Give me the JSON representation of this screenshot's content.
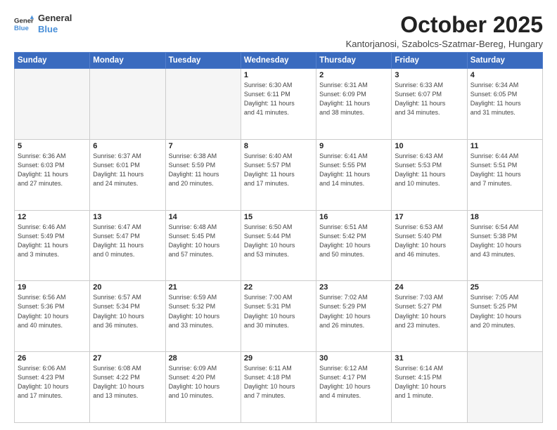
{
  "header": {
    "logo_line1": "General",
    "logo_line2": "Blue",
    "month_title": "October 2025",
    "location": "Kantorjanosi, Szabolcs-Szatmar-Bereg, Hungary"
  },
  "weekdays": [
    "Sunday",
    "Monday",
    "Tuesday",
    "Wednesday",
    "Thursday",
    "Friday",
    "Saturday"
  ],
  "weeks": [
    [
      {
        "day": "",
        "info": ""
      },
      {
        "day": "",
        "info": ""
      },
      {
        "day": "",
        "info": ""
      },
      {
        "day": "1",
        "info": "Sunrise: 6:30 AM\nSunset: 6:11 PM\nDaylight: 11 hours\nand 41 minutes."
      },
      {
        "day": "2",
        "info": "Sunrise: 6:31 AM\nSunset: 6:09 PM\nDaylight: 11 hours\nand 38 minutes."
      },
      {
        "day": "3",
        "info": "Sunrise: 6:33 AM\nSunset: 6:07 PM\nDaylight: 11 hours\nand 34 minutes."
      },
      {
        "day": "4",
        "info": "Sunrise: 6:34 AM\nSunset: 6:05 PM\nDaylight: 11 hours\nand 31 minutes."
      }
    ],
    [
      {
        "day": "5",
        "info": "Sunrise: 6:36 AM\nSunset: 6:03 PM\nDaylight: 11 hours\nand 27 minutes."
      },
      {
        "day": "6",
        "info": "Sunrise: 6:37 AM\nSunset: 6:01 PM\nDaylight: 11 hours\nand 24 minutes."
      },
      {
        "day": "7",
        "info": "Sunrise: 6:38 AM\nSunset: 5:59 PM\nDaylight: 11 hours\nand 20 minutes."
      },
      {
        "day": "8",
        "info": "Sunrise: 6:40 AM\nSunset: 5:57 PM\nDaylight: 11 hours\nand 17 minutes."
      },
      {
        "day": "9",
        "info": "Sunrise: 6:41 AM\nSunset: 5:55 PM\nDaylight: 11 hours\nand 14 minutes."
      },
      {
        "day": "10",
        "info": "Sunrise: 6:43 AM\nSunset: 5:53 PM\nDaylight: 11 hours\nand 10 minutes."
      },
      {
        "day": "11",
        "info": "Sunrise: 6:44 AM\nSunset: 5:51 PM\nDaylight: 11 hours\nand 7 minutes."
      }
    ],
    [
      {
        "day": "12",
        "info": "Sunrise: 6:46 AM\nSunset: 5:49 PM\nDaylight: 11 hours\nand 3 minutes."
      },
      {
        "day": "13",
        "info": "Sunrise: 6:47 AM\nSunset: 5:47 PM\nDaylight: 11 hours\nand 0 minutes."
      },
      {
        "day": "14",
        "info": "Sunrise: 6:48 AM\nSunset: 5:45 PM\nDaylight: 10 hours\nand 57 minutes."
      },
      {
        "day": "15",
        "info": "Sunrise: 6:50 AM\nSunset: 5:44 PM\nDaylight: 10 hours\nand 53 minutes."
      },
      {
        "day": "16",
        "info": "Sunrise: 6:51 AM\nSunset: 5:42 PM\nDaylight: 10 hours\nand 50 minutes."
      },
      {
        "day": "17",
        "info": "Sunrise: 6:53 AM\nSunset: 5:40 PM\nDaylight: 10 hours\nand 46 minutes."
      },
      {
        "day": "18",
        "info": "Sunrise: 6:54 AM\nSunset: 5:38 PM\nDaylight: 10 hours\nand 43 minutes."
      }
    ],
    [
      {
        "day": "19",
        "info": "Sunrise: 6:56 AM\nSunset: 5:36 PM\nDaylight: 10 hours\nand 40 minutes."
      },
      {
        "day": "20",
        "info": "Sunrise: 6:57 AM\nSunset: 5:34 PM\nDaylight: 10 hours\nand 36 minutes."
      },
      {
        "day": "21",
        "info": "Sunrise: 6:59 AM\nSunset: 5:32 PM\nDaylight: 10 hours\nand 33 minutes."
      },
      {
        "day": "22",
        "info": "Sunrise: 7:00 AM\nSunset: 5:31 PM\nDaylight: 10 hours\nand 30 minutes."
      },
      {
        "day": "23",
        "info": "Sunrise: 7:02 AM\nSunset: 5:29 PM\nDaylight: 10 hours\nand 26 minutes."
      },
      {
        "day": "24",
        "info": "Sunrise: 7:03 AM\nSunset: 5:27 PM\nDaylight: 10 hours\nand 23 minutes."
      },
      {
        "day": "25",
        "info": "Sunrise: 7:05 AM\nSunset: 5:25 PM\nDaylight: 10 hours\nand 20 minutes."
      }
    ],
    [
      {
        "day": "26",
        "info": "Sunrise: 6:06 AM\nSunset: 4:23 PM\nDaylight: 10 hours\nand 17 minutes."
      },
      {
        "day": "27",
        "info": "Sunrise: 6:08 AM\nSunset: 4:22 PM\nDaylight: 10 hours\nand 13 minutes."
      },
      {
        "day": "28",
        "info": "Sunrise: 6:09 AM\nSunset: 4:20 PM\nDaylight: 10 hours\nand 10 minutes."
      },
      {
        "day": "29",
        "info": "Sunrise: 6:11 AM\nSunset: 4:18 PM\nDaylight: 10 hours\nand 7 minutes."
      },
      {
        "day": "30",
        "info": "Sunrise: 6:12 AM\nSunset: 4:17 PM\nDaylight: 10 hours\nand 4 minutes."
      },
      {
        "day": "31",
        "info": "Sunrise: 6:14 AM\nSunset: 4:15 PM\nDaylight: 10 hours\nand 1 minute."
      },
      {
        "day": "",
        "info": ""
      }
    ]
  ]
}
